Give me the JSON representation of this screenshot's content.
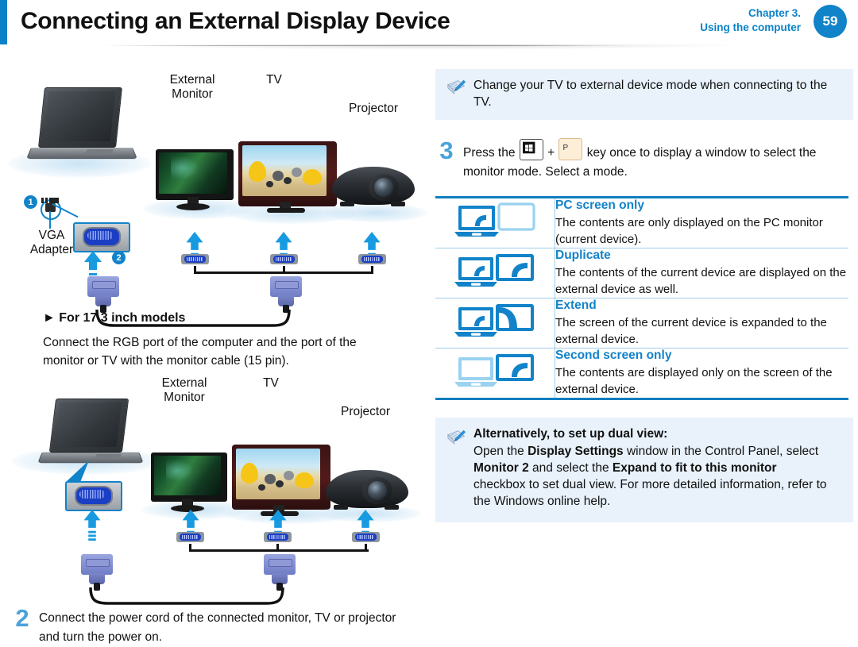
{
  "header": {
    "title": "Connecting an External Display Device",
    "chapter_line1": "Chapter 3.",
    "chapter_line2": "Using the computer",
    "page_number": "59",
    "accent_color": "#0b82c8"
  },
  "left": {
    "diagram_top": {
      "labels": {
        "external_monitor": "External\nMonitor",
        "external_monitor_l1": "External",
        "external_monitor_l2": "Monitor",
        "tv": "TV",
        "projector": "Projector",
        "vga_adapter_l1": "VGA",
        "vga_adapter_l2": "Adapter"
      },
      "callouts": [
        "1",
        "2"
      ]
    },
    "section_heading": "► For 17.3 inch models",
    "section_paragraph": "Connect the RGB port of the computer and the port of the monitor or TV with the monitor cable (15 pin).",
    "diagram_bottom": {
      "labels": {
        "external_monitor_l1": "External",
        "external_monitor_l2": "Monitor",
        "tv": "TV",
        "projector": "Projector"
      }
    },
    "step2": {
      "number": "2",
      "text": "Connect the power cord of the connected monitor, TV or projector and turn the power on."
    }
  },
  "right": {
    "note_top": {
      "icon": "note-pencil-icon",
      "text": "Change your TV to external device mode when connecting to the TV."
    },
    "step3": {
      "number": "3",
      "text_before": "Press the",
      "key_win": "windows-logo-key",
      "plus": "+",
      "key_p": "P",
      "text_after": "key once to display a window to select the monitor mode. Select a mode."
    },
    "mode_table": {
      "border_color": "#0f7ec0",
      "rows": [
        {
          "icon": "pc-screen-only-icon",
          "name": "PC  screen only",
          "desc": "The contents are only displayed on the PC monitor (current device)."
        },
        {
          "icon": "duplicate-icon",
          "name": "Duplicate",
          "desc": "The contents of the current device are displayed on the external device as well."
        },
        {
          "icon": "extend-icon",
          "name": "Extend",
          "desc": "The screen of the current device is expanded to the external device."
        },
        {
          "icon": "second-screen-only-icon",
          "name": "Second screen only",
          "desc": "The contents are displayed only on the screen of the external device."
        }
      ]
    },
    "note_bottom": {
      "icon": "note-pencil-icon",
      "title": "Alternatively, to set up dual view:",
      "seg1": "Open the ",
      "b1": "Display Settings",
      "seg2": " window in the Control Panel, select ",
      "b2": "Monitor 2",
      "seg3": " and select the ",
      "b3": "Expand to fit to this monitor",
      "seg4": " checkbox to set dual view. For more detailed information, refer to the Windows online help."
    }
  }
}
